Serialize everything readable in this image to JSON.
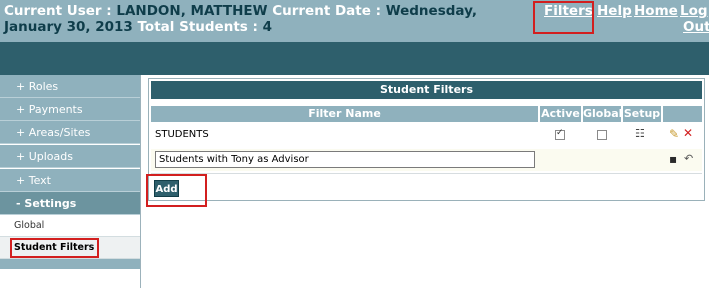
{
  "header": {
    "current_user_label": "Current User :",
    "current_user": "LANDON, MATTHEW",
    "current_date_label": "Current Date :",
    "current_date": "Wednesday, January 30, 2013",
    "total_students_label": "Total Students :",
    "total_students": "4",
    "nav": {
      "filters": "Filters",
      "help": "Help",
      "home": "Home",
      "logout_line1": "Log",
      "logout_line2": "Out"
    }
  },
  "sidebar": {
    "items": [
      {
        "label": "+ Roles"
      },
      {
        "label": "+ Payments"
      },
      {
        "label": "+ Areas/Sites"
      },
      {
        "label": "+ Uploads"
      },
      {
        "label": "+ Text"
      },
      {
        "label": "- Settings"
      }
    ],
    "sub_items": [
      {
        "label": "Global"
      },
      {
        "label": "Student Filters"
      }
    ]
  },
  "panel": {
    "title": "Student Filters",
    "columns": {
      "filter_name": "Filter Name",
      "active": "Active",
      "global": "Global",
      "setup": "Setup"
    },
    "rows": [
      {
        "name": "STUDENTS",
        "active": true,
        "global": false
      }
    ],
    "new_filter_value": "Students with Tony as Advisor",
    "add_label": "Add"
  },
  "colors": {
    "header_bg": "#8fb1bd",
    "band_bg": "#2e5f6c",
    "highlight": "#d21f1f"
  }
}
